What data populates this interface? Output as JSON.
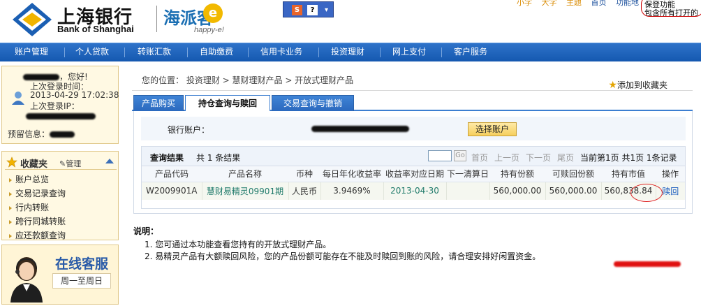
{
  "header": {
    "logo_cn": "上海银行",
    "logo_en": "Bank of Shanghai",
    "happy_cn": "海派客",
    "happy_e": "e",
    "happy_en": "happy-e!",
    "toolbar_buttons": [
      "S",
      "?",
      "▾"
    ],
    "top_links": [
      "小字",
      "大字",
      "主题",
      "首页",
      "功能地"
    ],
    "tooltip_lines": [
      "保登功能",
      "包含所有打开的"
    ]
  },
  "nav": {
    "items": [
      "账户管理",
      "个人贷款",
      "转账汇款",
      "自助缴费",
      "信用卡业务",
      "投资理财",
      "网上支付",
      "客户服务"
    ]
  },
  "sidebar": {
    "greeting_suffix": "，您好!",
    "last_login_time_label": "上次登录时间：",
    "last_login_time": "2013-04-29 17:02:38",
    "last_login_ip_label": "上次登录IP：",
    "reserved_info_label": "预留信息：",
    "favorites_title": "收藏夹",
    "favorites_manage": "管理",
    "favorites_items": [
      "账户总览",
      "交易记录查询",
      "行内转账",
      "跨行同城转账",
      "应还款额查询"
    ],
    "cs_title": "在线客服",
    "cs_sub": "周一至周日"
  },
  "main": {
    "breadcrumb": "您的位置：  投资理财 >  慧财理财产品 >  开放式理财产品",
    "add_favorite": "添加到收藏夹",
    "tabs": [
      "产品购买",
      "持仓查询与赎回",
      "交易查询与撤销"
    ],
    "account_label": "银行账户：",
    "select_account": "选择账户",
    "result": {
      "title": "查询结果",
      "count": "共 1 条结果",
      "go": "Go",
      "pager": [
        "首页",
        "上一页",
        "下一页",
        "尾页"
      ],
      "page_status": "当前第1页 共1页 1条记录",
      "columns": [
        "产品代码",
        "产品名称",
        "币种",
        "每日年化收益率",
        "收益率对应日期",
        "下一清算日",
        "持有份额",
        "可赎回份额",
        "持有市值",
        "操作"
      ],
      "rows": [
        [
          "W2009901A",
          "慧财易精灵09901期",
          "人民币",
          "3.9469%",
          "2013-04-30",
          "",
          "560,000.00",
          "560,000.00",
          "560,838.84",
          "赎回"
        ]
      ]
    },
    "notes_title": "说明：",
    "notes": [
      "1. 您可通过本功能查看您持有的开放式理财产品。",
      "2. 易精灵产品有大额赎回风险，您的产品份额可能存在不能及时赎回到账的风险，请合理安排好闲置资金。"
    ]
  },
  "colors": {
    "nav_blue": "#1558b0",
    "tab_blue": "#2b69be",
    "sidebar_bg": "#fff9e3",
    "link_teal": "#1f7a6a"
  }
}
